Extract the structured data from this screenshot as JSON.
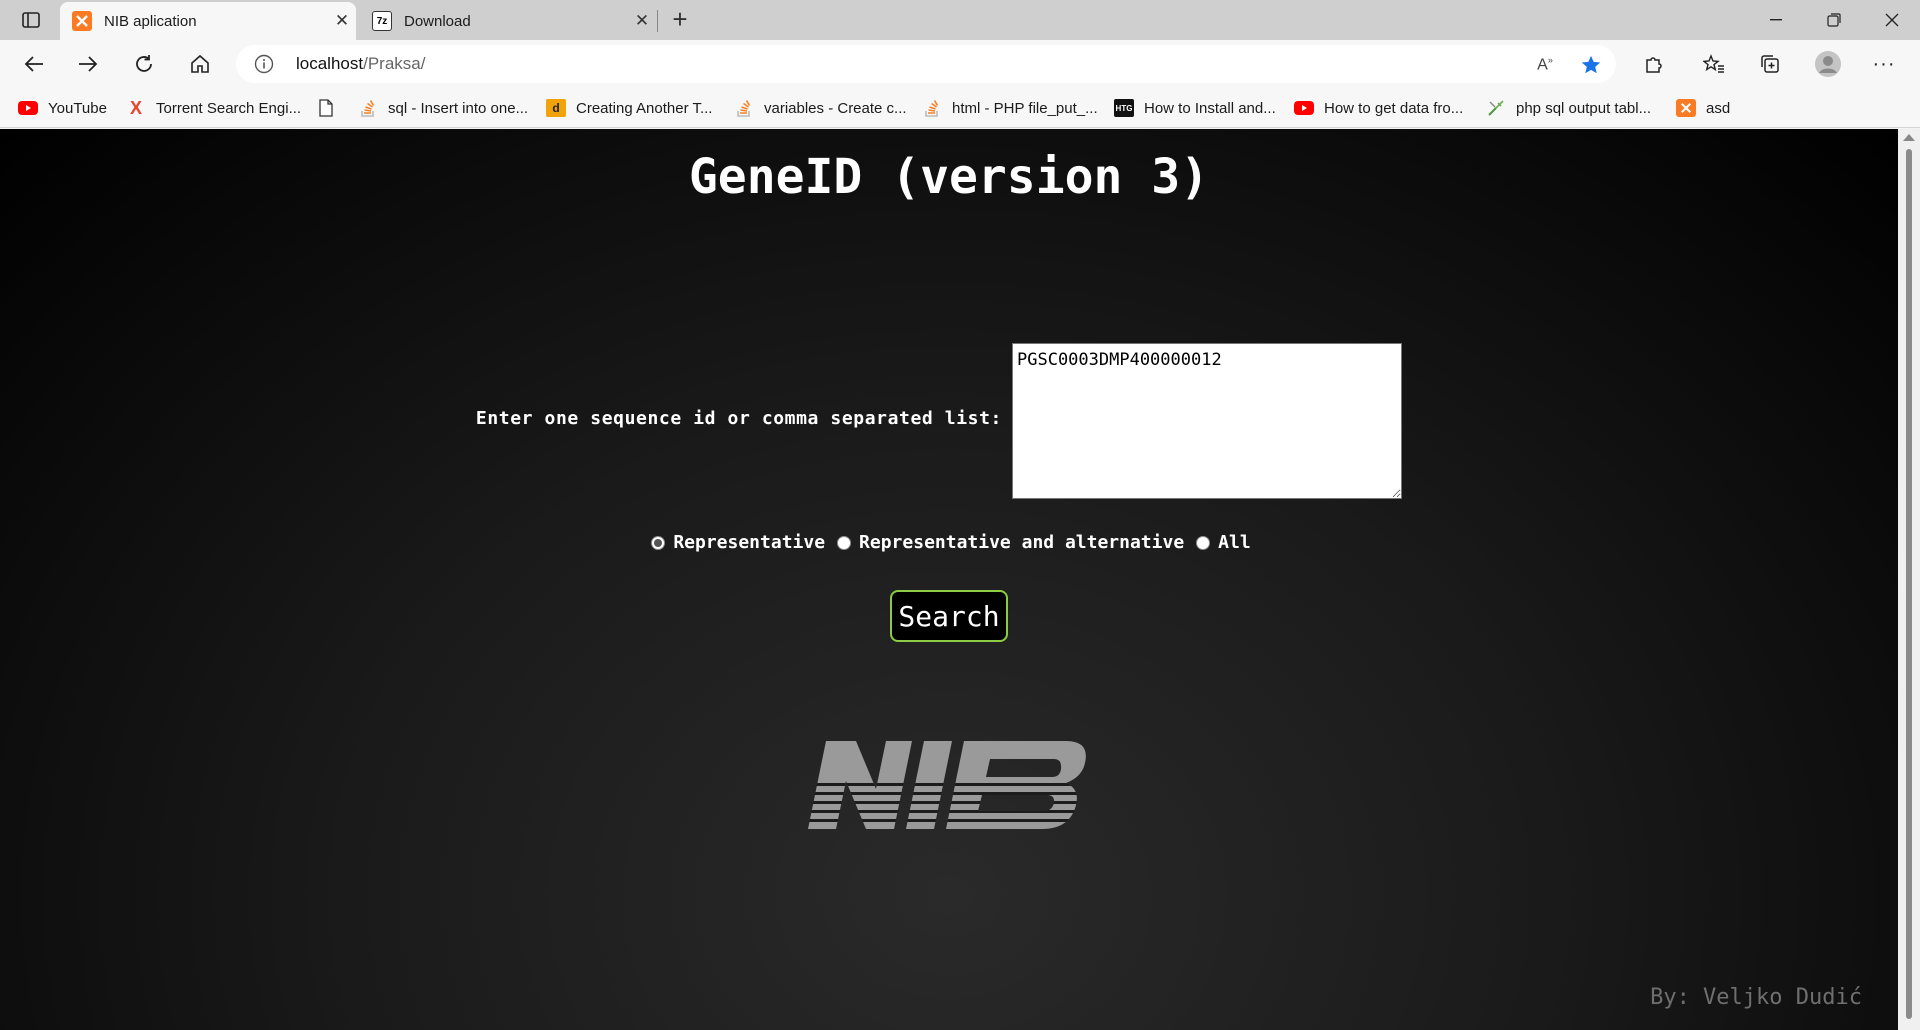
{
  "browser": {
    "tabs": [
      {
        "title": "NIB aplication",
        "active": true,
        "icon": "xampp-icon"
      },
      {
        "title": "Download",
        "active": false,
        "icon": "7zip-icon"
      }
    ],
    "address": {
      "host": "localhost",
      "path": "/Praksa/"
    },
    "bookmarks": [
      {
        "label": "YouTube",
        "icon": "youtube-icon"
      },
      {
        "label": "Torrent Search Engi...",
        "icon": "torrent-x-icon"
      },
      {
        "label": "",
        "icon": "page-icon"
      },
      {
        "label": "sql - Insert into one...",
        "icon": "stackoverflow-icon"
      },
      {
        "label": "Creating Another T...",
        "icon": "d-icon"
      },
      {
        "label": "variables - Create c...",
        "icon": "stackoverflow-icon"
      },
      {
        "label": "html - PHP file_put_...",
        "icon": "stackoverflow-icon"
      },
      {
        "label": "How to Install and...",
        "icon": "htg-icon"
      },
      {
        "label": "How to get data fro...",
        "icon": "youtube-icon"
      },
      {
        "label": "php sql output tabl...",
        "icon": "tool-icon"
      },
      {
        "label": "asd",
        "icon": "xampp-icon"
      }
    ]
  },
  "page": {
    "title": "GeneID (version 3)",
    "prompt": "Enter one sequence id or comma separated list:",
    "sequence_value": "PGSC0003DMP400000012",
    "radio_options": [
      {
        "label": "Representative",
        "checked": true
      },
      {
        "label": "Representative and alternative",
        "checked": false
      },
      {
        "label": "All",
        "checked": false
      }
    ],
    "search_label": "Search",
    "logo_text": "NIB",
    "byline": "By: Veljko Dudić"
  },
  "colors": {
    "button_border": "#8ccb44",
    "page_bg": "#1a1a1a",
    "logo_gray": "#9a9a9a"
  }
}
